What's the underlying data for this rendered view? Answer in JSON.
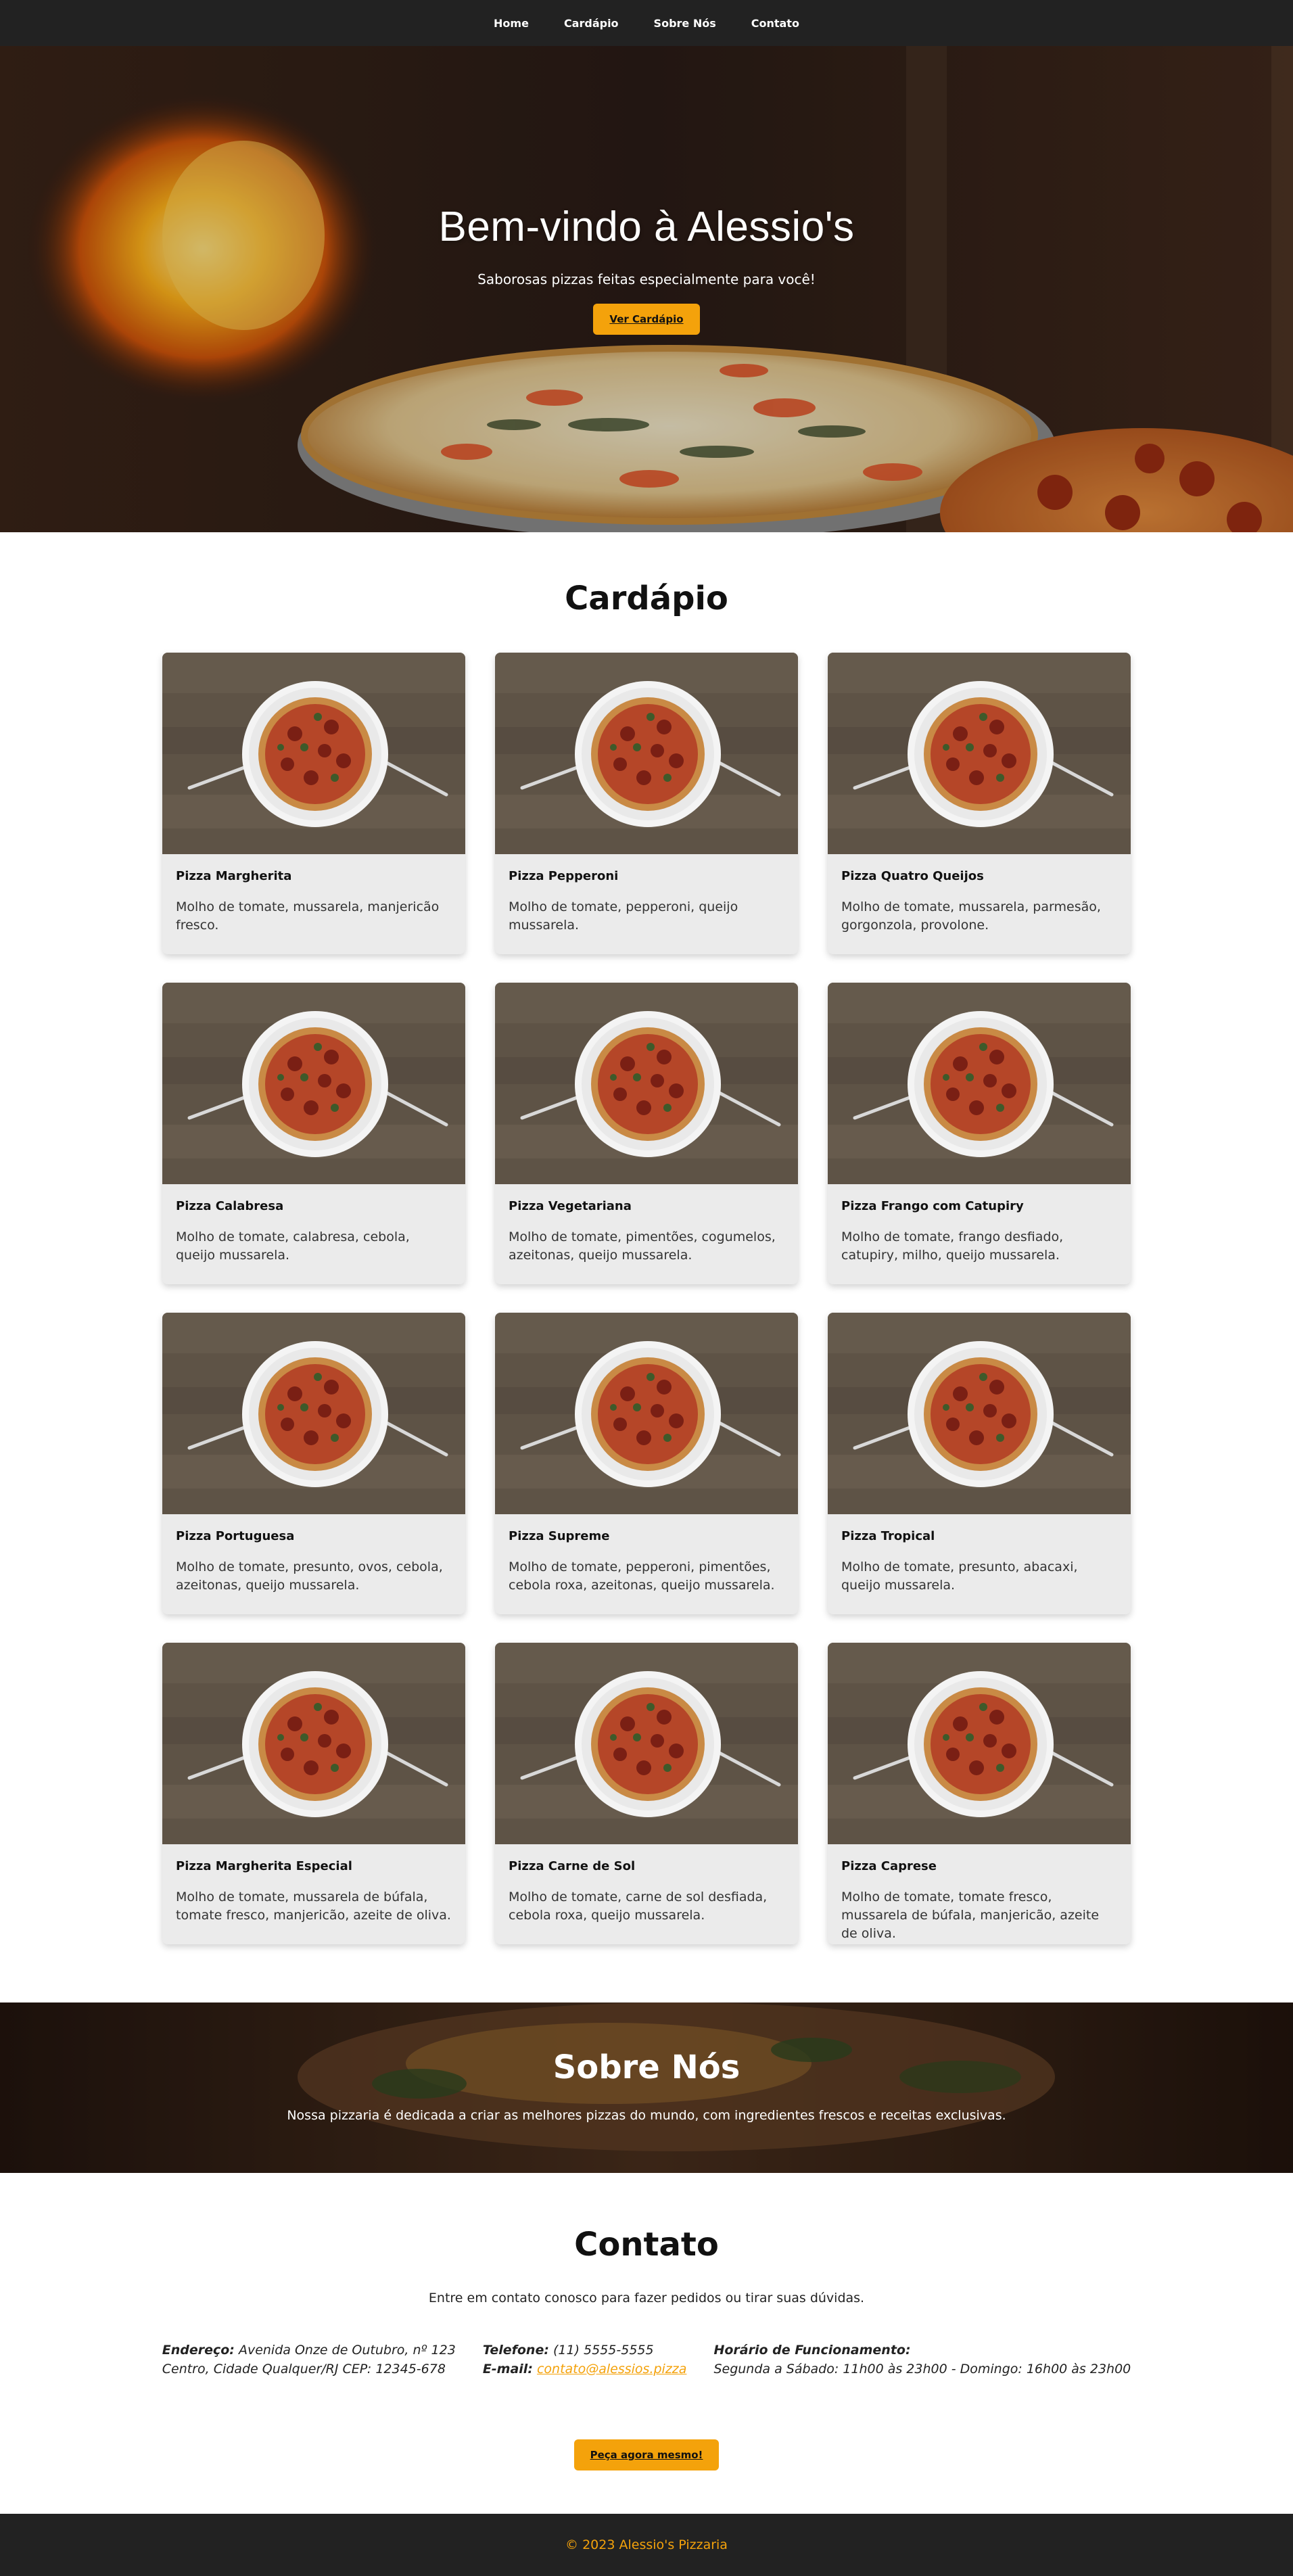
{
  "nav": {
    "items": [
      {
        "label": "Home"
      },
      {
        "label": "Cardápio"
      },
      {
        "label": "Sobre Nós"
      },
      {
        "label": "Contato"
      }
    ]
  },
  "hero": {
    "title": "Bem-vindo à Alessio's",
    "subtitle": "Saborosas pizzas feitas especialmente para você!",
    "button_label": "Ver Cardápio"
  },
  "menu": {
    "title": "Cardápio",
    "items": [
      {
        "name": "Pizza Margherita",
        "description": "Molho de tomate, mussarela, manjericão fresco."
      },
      {
        "name": "Pizza Pepperoni",
        "description": "Molho de tomate, pepperoni, queijo mussarela."
      },
      {
        "name": "Pizza Quatro Queijos",
        "description": "Molho de tomate, mussarela, parmesão, gorgonzola, provolone."
      },
      {
        "name": "Pizza Calabresa",
        "description": "Molho de tomate, calabresa, cebola, queijo mussarela."
      },
      {
        "name": "Pizza Vegetariana",
        "description": "Molho de tomate, pimentões, cogumelos, azeitonas, queijo mussarela."
      },
      {
        "name": "Pizza Frango com Catupiry",
        "description": "Molho de tomate, frango desfiado, catupiry, milho, queijo mussarela."
      },
      {
        "name": "Pizza Portuguesa",
        "description": "Molho de tomate, presunto, ovos, cebola, azeitonas, queijo mussarela."
      },
      {
        "name": "Pizza Supreme",
        "description": "Molho de tomate, pepperoni, pimentões, cebola roxa, azeitonas, queijo mussarela."
      },
      {
        "name": "Pizza Tropical",
        "description": "Molho de tomate, presunto, abacaxi, queijo mussarela."
      },
      {
        "name": "Pizza Margherita Especial",
        "description": "Molho de tomate, mussarela de búfala, tomate fresco, manjericão, azeite de oliva."
      },
      {
        "name": "Pizza Carne de Sol",
        "description": "Molho de tomate, carne de sol desfiada, cebola roxa, queijo mussarela."
      },
      {
        "name": "Pizza Caprese",
        "description": "Molho de tomate, tomate fresco, mussarela de búfala, manjericão, azeite de oliva."
      }
    ]
  },
  "about": {
    "title": "Sobre Nós",
    "text": "Nossa pizzaria é dedicada a criar as melhores pizzas do mundo, com ingredientes frescos e receitas exclusivas."
  },
  "contact": {
    "title": "Contato",
    "lead": "Entre em contato conosco para fazer pedidos ou tirar suas dúvidas.",
    "address_label": "Endereço:",
    "address_line1": "Avenida Onze de Outubro, nº 123",
    "address_line2": "Centro, Cidade Qualquer/RJ CEP: 12345-678",
    "phone_label": "Telefone:",
    "phone": "(11) 5555-5555",
    "email_label": "E-mail:",
    "email": "contato@alessios.pizza",
    "hours_label": "Horário de Funcionamento:",
    "hours": "Segunda a Sábado: 11h00 às 23h00 - Domingo: 16h00 às 23h00",
    "order_button": "Peça agora mesmo!"
  },
  "footer": {
    "text": "© 2023 Alessio's Pizzaria"
  },
  "colors": {
    "accent": "#f4a20b",
    "dark": "#222222",
    "card_bg": "#ebebeb"
  }
}
